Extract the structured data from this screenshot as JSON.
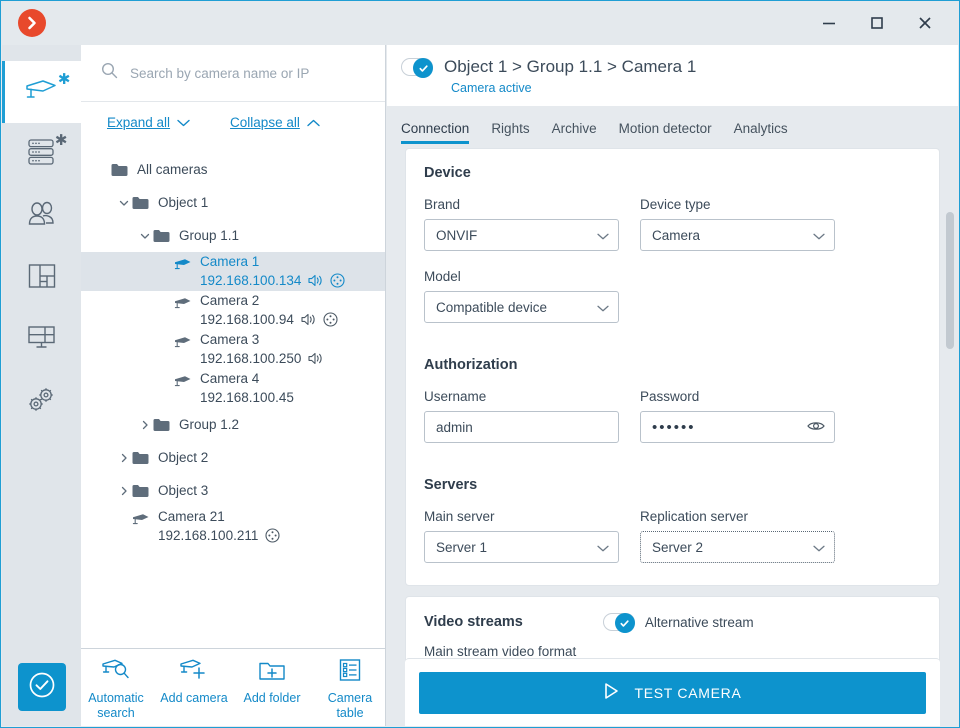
{
  "window": {
    "minimize_label": "Minimize",
    "maximize_label": "Maximize",
    "close_label": "Close"
  },
  "rail": {
    "items": [
      {
        "icon": "camera-icon",
        "badge": "*",
        "active": true
      },
      {
        "icon": "servers-icon",
        "badge": "*",
        "active": false
      },
      {
        "icon": "users-icon",
        "badge": "",
        "active": false
      },
      {
        "icon": "layouts-icon",
        "badge": "",
        "active": false
      },
      {
        "icon": "video-wall-icon",
        "badge": "",
        "active": false
      },
      {
        "icon": "settings-gears-icon",
        "badge": "",
        "active": false
      }
    ],
    "confirm_icon": "check-circle-icon"
  },
  "search": {
    "placeholder": "Search by camera name or IP",
    "value": "",
    "icon": "search-icon"
  },
  "tree_actions": {
    "expand_all": "Expand all",
    "collapse_all": "Collapse all"
  },
  "tree": [
    {
      "type": "folder",
      "label": "All cameras",
      "indent": 0,
      "caret": "none"
    },
    {
      "type": "folder",
      "label": "Object 1",
      "indent": 1,
      "caret": "down"
    },
    {
      "type": "folder",
      "label": "Group 1.1",
      "indent": 2,
      "caret": "down"
    },
    {
      "type": "camera",
      "label": "Camera 1",
      "ip": "192.168.100.134",
      "indent": 3,
      "selected": true,
      "badges": [
        "audio-icon",
        "ptz-icon"
      ]
    },
    {
      "type": "camera",
      "label": "Camera 2",
      "ip": "192.168.100.94",
      "indent": 3,
      "selected": false,
      "badges": [
        "audio-icon",
        "ptz-icon"
      ]
    },
    {
      "type": "camera",
      "label": "Camera 3",
      "ip": "192.168.100.250",
      "indent": 3,
      "selected": false,
      "badges": [
        "audio-icon"
      ]
    },
    {
      "type": "camera",
      "label": "Camera 4",
      "ip": "192.168.100.45",
      "indent": 3,
      "selected": false,
      "badges": []
    },
    {
      "type": "folder",
      "label": "Group 1.2",
      "indent": 2,
      "caret": "right"
    },
    {
      "type": "folder",
      "label": "Object 2",
      "indent": 1,
      "caret": "right"
    },
    {
      "type": "folder",
      "label": "Object 3",
      "indent": 1,
      "caret": "right"
    },
    {
      "type": "camera",
      "label": "Camera 21",
      "ip": "192.168.100.211",
      "indent": 1,
      "selected": false,
      "badges": [
        "ptz-icon"
      ]
    }
  ],
  "tree_toolbar": [
    {
      "icon": "camera-search-icon",
      "label": "Automatic search"
    },
    {
      "icon": "camera-plus-icon",
      "label": "Add camera"
    },
    {
      "icon": "folder-plus-icon",
      "label": "Add folder"
    },
    {
      "icon": "table-list-icon",
      "label": "Camera table"
    }
  ],
  "detail": {
    "enabled": true,
    "title": "Object 1 > Group 1.1 > Camera 1",
    "status": "Camera active",
    "tabs": [
      {
        "label": "Connection",
        "active": true
      },
      {
        "label": "Rights",
        "active": false
      },
      {
        "label": "Archive",
        "active": false
      },
      {
        "label": "Motion detector",
        "active": false
      },
      {
        "label": "Analytics",
        "active": false
      }
    ]
  },
  "device": {
    "heading": "Device",
    "brand_label": "Brand",
    "brand_value": "ONVIF",
    "device_type_label": "Device type",
    "device_type_value": "Camera",
    "model_label": "Model",
    "model_value": "Compatible device"
  },
  "authorization": {
    "heading": "Authorization",
    "username_label": "Username",
    "username_value": "admin",
    "password_label": "Password",
    "password_value": "••••••",
    "reveal_icon": "eye-icon"
  },
  "servers": {
    "heading": "Servers",
    "main_label": "Main server",
    "main_value": "Server 1",
    "replication_label": "Replication server",
    "replication_value": "Server 2"
  },
  "video_streams": {
    "heading": "Video streams",
    "alternative_stream_label": "Alternative stream",
    "alternative_stream_enabled": true,
    "main_stream_format_label": "Main stream video format"
  },
  "footer": {
    "test_camera_label": "TEST CAMERA",
    "test_camera_icon": "play-icon"
  },
  "colors": {
    "accent": "#0d93cd",
    "link": "#1389c8",
    "logo": "#e8492c",
    "text": "#3c4b5a",
    "panel_bg": "#e6eaee"
  }
}
